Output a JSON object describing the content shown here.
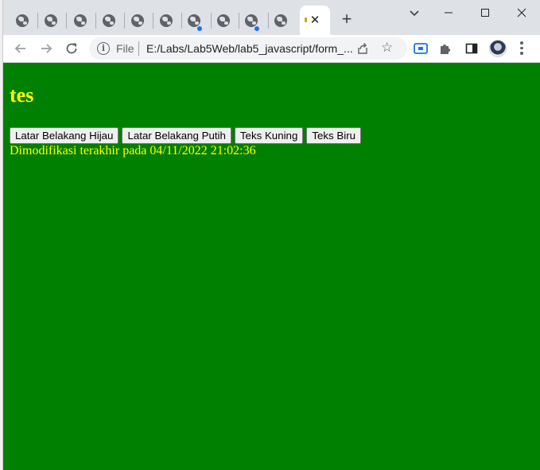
{
  "browser": {
    "inactive_tab_count": 10,
    "active_tab": {
      "close_glyph": "✕"
    },
    "new_tab_glyph": "+",
    "window_controls": {
      "minimize": "—",
      "maximize": "☐",
      "close": "✕"
    },
    "address_bar": {
      "scheme_label": "File",
      "url": "E:/Labs/Lab5Web/lab5_javascript/form_..."
    },
    "icons": [
      "back-icon",
      "forward-icon",
      "reload-icon",
      "info-icon",
      "share-icon",
      "star-icon",
      "cast-icon",
      "extensions-icon",
      "side-panel-icon",
      "avatar",
      "menu-icon"
    ]
  },
  "page": {
    "heading": "tes",
    "buttons": [
      {
        "label": "Latar Belakang Hijau"
      },
      {
        "label": "Latar Belakang Putih"
      },
      {
        "label": "Teks Kuning"
      },
      {
        "label": "Teks Biru"
      }
    ],
    "last_modified": "Dimodifikasi terakhir pada 04/11/2022 21:02:36",
    "colors": {
      "background": "#008000",
      "text": "#ffff00"
    }
  }
}
